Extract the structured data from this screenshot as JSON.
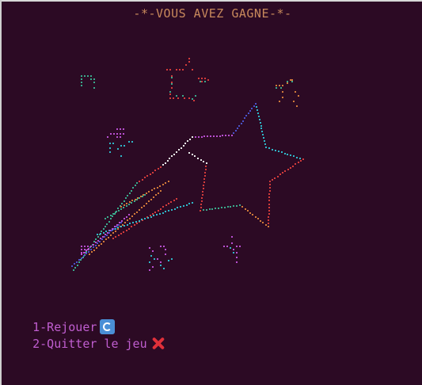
{
  "window": {
    "title": "-*-VOUS AVEZ GAGNE-*-"
  },
  "menu": {
    "items": [
      {
        "label": "1-Rejouer",
        "icon": "replay-icon"
      },
      {
        "label": "2-Quitter le jeu",
        "icon": "cross-mark-icon"
      }
    ]
  },
  "colors": {
    "background": "#2c0a24",
    "title": "#c8895c",
    "menu_text": "#c05ed0",
    "art_palette": [
      "#d23b3b",
      "#3aaa8c",
      "#2fb7c8",
      "#b84fd0",
      "#d07a3a",
      "#4a52c8",
      "#e8e8e8"
    ]
  }
}
